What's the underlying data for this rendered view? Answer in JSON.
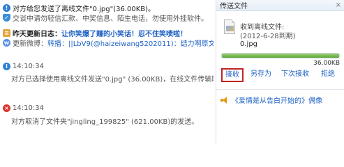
{
  "chat": {
    "line1": {
      "text": "对方给您发送了离线文件\"0.jpg\"(36.00KB)。",
      "icon": "notice-icon"
    },
    "line2": {
      "text": "交谈中请勿轻信汇款、中奖信息、陌生电话，勿使用外挂软件。",
      "icon": "shield-icon"
    },
    "line3": {
      "prefix": "昨天更新日志：",
      "link": "让你笑爆了赚的小笑话！忍不住笑喷啦！",
      "icon": "log-icon"
    },
    "line4": {
      "prefix": "更新微博：",
      "text": "转播：||LbV9(@haizeiwang5202011)：结力啊原文 搞笑图...",
      "icon": "weibo-icon"
    },
    "line5": {
      "time": "14:10:34",
      "text": "对方已选择使用离线文件发送\"0.jpg\" (36.00KB)，在线文件传输取消。",
      "icon": "info-icon"
    },
    "line6": {
      "time": "14:10:34",
      "text": "对方取消了文件夹\"jingling_199825\" (621.00KB)的发送。",
      "icon": "error-icon"
    }
  },
  "side": {
    "title": "传送文件",
    "close": "×",
    "file": {
      "status": "收到离线文件:",
      "date": "(2012-6-28到期)",
      "name": "0.jpg",
      "size": "36.00KB",
      "progress": 1.0
    },
    "actions": {
      "receive": "接收",
      "save_as": "另存为",
      "later": "下次接收",
      "reject": "拒绝"
    },
    "song": "《爱情是从告白开始的》偶像"
  }
}
